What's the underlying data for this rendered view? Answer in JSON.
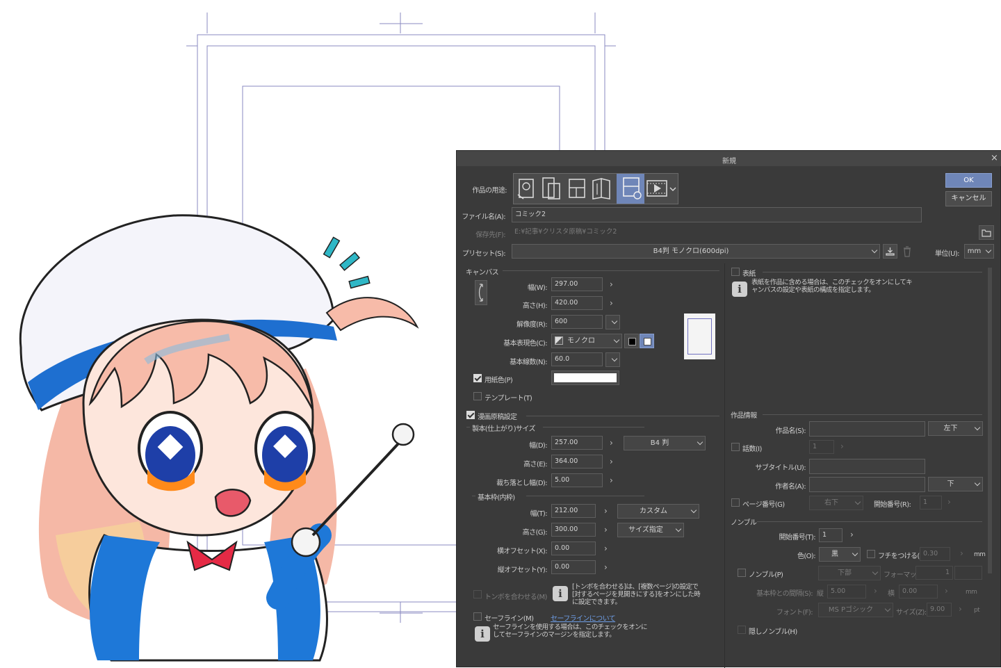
{
  "dialog": {
    "title": "新規",
    "close_glyph": "×",
    "ok_label": "OK",
    "cancel_label": "キャンセル",
    "usage_label": "作品の用途:",
    "usage_icons": [
      "illustration-icon",
      "webtoon-icon",
      "comic-icon",
      "book-icon",
      "all-comic-settings-icon",
      "animation-icon"
    ],
    "usage_selected": "all-comic-settings-icon",
    "filename_label": "ファイル名(A):",
    "filename_value": "コミック2",
    "save_to_label": "保存先(F):",
    "save_to_value": "E:¥記事¥クリスタ原稿¥コミック2",
    "preset_label": "プリセット(S):",
    "preset_value": "B4判 モノクロ(600dpi)",
    "unit_label": "単位(U):",
    "unit_value": "mm"
  },
  "canvas": {
    "section_label": "キャンバス",
    "width_label": "幅(W):",
    "width_value": "297.00",
    "height_label": "高さ(H):",
    "height_value": "420.00",
    "resolution_label": "解像度(R):",
    "resolution_value": "600",
    "color_label": "基本表現色(C):",
    "color_value": "モノクロ",
    "lines_label": "基本線数(N):",
    "lines_value": "60.0",
    "paper_color_label": "用紙色(P)",
    "template_label": "テンプレート(T)"
  },
  "manga": {
    "section_label": "漫画原稿設定",
    "bleed_section_label": "製本(仕上がり)サイズ",
    "bleed_width_label": "幅(D):",
    "bleed_width_value": "257.00",
    "bleed_size_value": "B4 判",
    "bleed_height_label": "高さ(E):",
    "bleed_height_value": "364.00",
    "bleed_margin_label": "裁ち落とし幅(D):",
    "bleed_margin_value": "5.00",
    "frame_section_label": "基本枠(内枠)",
    "frame_width_label": "幅(T):",
    "frame_width_value": "212.00",
    "frame_type_value": "カスタム",
    "frame_height_label": "高さ(G):",
    "frame_height_value": "300.00",
    "frame_spec_value": "サイズ指定",
    "offset_x_label": "横オフセット(X):",
    "offset_x_value": "0.00",
    "offset_y_label": "縦オフセット(Y):",
    "offset_y_value": "0.00",
    "align_tombo_label": "トンボを合わせる(M)",
    "align_tombo_note": "[トンボを合わせる]は、[複数ページ]の設定で[対するページを見開きにする]をオンにした時に設定できます。",
    "safe_line_label": "セーフライン(M)",
    "safe_line_link": "セーフラインについて",
    "safe_line_note": "セーフラインを使用する場合は、このチェックをオンにしてセーフラインのマージンを指定します。"
  },
  "cover": {
    "label": "表紙",
    "note": "表紙を作品に含める場合は、このチェックをオンにしてキャンバスの設定や表紙の構成を指定します。"
  },
  "work_info": {
    "section_label": "作品情報",
    "title_label": "作品名(S):",
    "title_pos": "左下",
    "episode_label": "話数(I)",
    "episode_value": "1",
    "subtitle_label": "サブタイトル(U):",
    "author_label": "作者名(A):",
    "author_pos": "下",
    "page_number_label": "ページ番号(G)",
    "page_number_pos": "右下",
    "start_number_label": "開始番号(R):",
    "start_number_value": "1"
  },
  "nombre": {
    "section_label": "ノンブル",
    "start_label": "開始番号(T):",
    "start_value": "1",
    "color_label": "色(O):",
    "color_value": "黒",
    "border_label": "フチをつける(E)",
    "border_value": "0.30",
    "border_unit": "mm",
    "nombre_label": "ノンブル(P)",
    "position_value": "下部",
    "format_label": "フォーマット:",
    "format_value": "1",
    "gap_label": "基本枠との間隔(S):",
    "gap_v_label": "縦",
    "gap_v_value": "5.00",
    "gap_h_label": "横",
    "gap_h_value": "0.00",
    "gap_unit": "mm",
    "font_label": "フォント(F):",
    "font_value": "MS Pゴシック",
    "size_label": "サイズ(Z):",
    "size_value": "9.00",
    "size_unit": "pt",
    "hidden_label": "隠しノンブル(H)"
  },
  "colors": {
    "dialog_bg": "#3a3a3a",
    "accent_selected": "#6f86b8"
  }
}
